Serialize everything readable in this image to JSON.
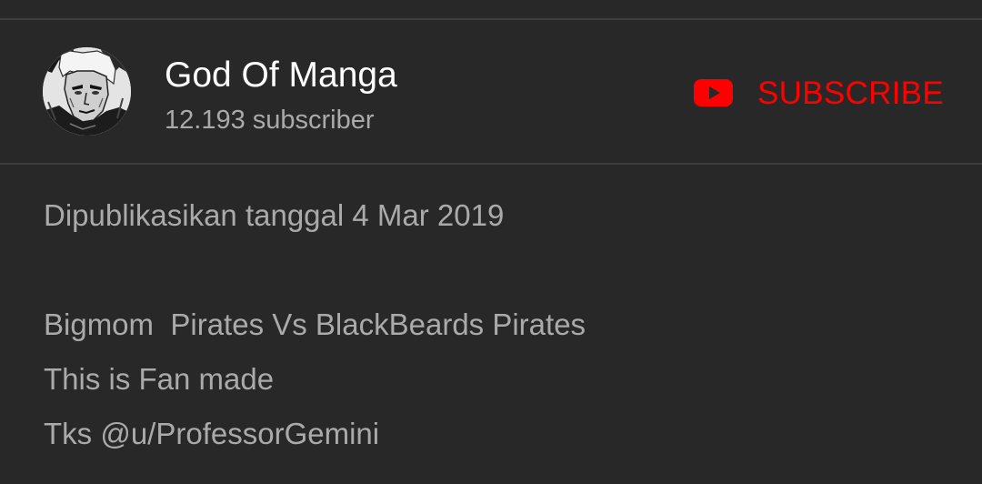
{
  "channel": {
    "name": "God Of Manga",
    "subscribers": "12.193 subscriber",
    "avatar_icon": "manga-character-avatar"
  },
  "subscribe": {
    "label": "SUBSCRIBE",
    "icon": "youtube-play-icon",
    "color": "#ff0000"
  },
  "description": {
    "published": "Dipublikasikan tanggal 4 Mar 2019",
    "lines": [
      "Bigmom  Pirates Vs BlackBeards Pirates",
      "This is Fan made",
      "Tks @u/ProfessorGemini"
    ]
  },
  "colors": {
    "background": "#282828",
    "divider": "#3d3d3d",
    "primary_text": "#ffffff",
    "secondary_text": "#aaaaaa"
  }
}
